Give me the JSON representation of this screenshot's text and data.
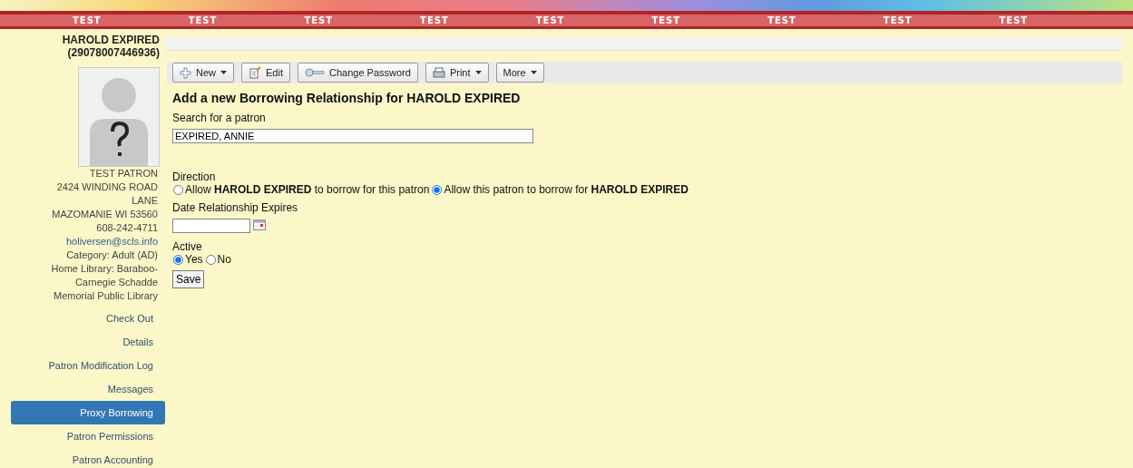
{
  "banner": {
    "labels": [
      "TEST",
      "TEST",
      "TEST",
      "TEST",
      "TEST",
      "TEST",
      "TEST",
      "TEST",
      "TEST"
    ]
  },
  "patron": {
    "name": "HAROLD EXPIRED",
    "barcode": "(29078007446936)",
    "details": [
      "TEST PATRON",
      "2424 WINDING ROAD LANE",
      "MAZOMANIE WI 53560",
      "608-242-4711"
    ],
    "email": "holiversen@scls.info",
    "extra": [
      "Category: Adult (AD)",
      "Home Library: Baraboo-Carnegie Schadde Memorial Public Library"
    ]
  },
  "sidebar": {
    "items": [
      {
        "label": "Check Out",
        "selected": false
      },
      {
        "label": "Details",
        "selected": false
      },
      {
        "label": "Patron Modification Log",
        "selected": false
      },
      {
        "label": "Messages",
        "selected": false
      },
      {
        "label": "Proxy Borrowing",
        "selected": true
      },
      {
        "label": "Patron Permissions",
        "selected": false
      },
      {
        "label": "Patron Accounting",
        "selected": false
      }
    ]
  },
  "toolbar": {
    "buttons": [
      {
        "label": "New",
        "kind": "new",
        "menu": true
      },
      {
        "label": "Edit",
        "kind": "edit",
        "menu": false
      },
      {
        "label": "Change Password",
        "kind": "key",
        "menu": false
      },
      {
        "label": "Print",
        "kind": "print",
        "menu": true
      },
      {
        "label": "More",
        "kind": "none",
        "menu": true
      }
    ]
  },
  "form": {
    "title": "Add a new Borrowing Relationship for HAROLD EXPIRED",
    "search_label": "Search for a patron",
    "search_value": "EXPIRED, ANNIE",
    "direction_label": "Direction",
    "direction_options": [
      {
        "label": "Allow **HAROLD EXPIRED** to borrow for this patron",
        "selected": false
      },
      {
        "label": "Allow this patron to borrow for **HAROLD EXPIRED**",
        "selected": true
      }
    ],
    "date_label": "Date Relationship Expires",
    "active_label": "Active",
    "active_options": [
      {
        "label": "Yes",
        "selected": true
      },
      {
        "label": "No",
        "selected": false
      }
    ],
    "save": "Save"
  }
}
